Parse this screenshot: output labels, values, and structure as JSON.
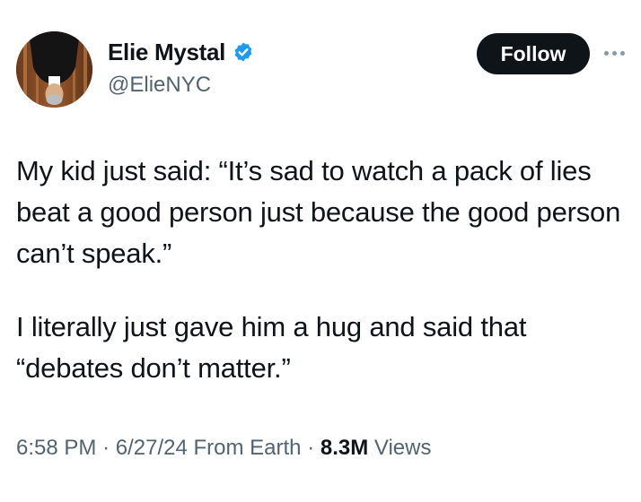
{
  "author": {
    "display_name": "Elie Mystal",
    "handle": "@ElieNYC",
    "verified": true,
    "verified_color": "#1d9bf0",
    "avatar_icon": "profile-photo"
  },
  "actions": {
    "follow_label": "Follow",
    "more_icon": "more-options-icon"
  },
  "tweet": {
    "paragraphs": [
      "My kid just said: “It’s sad to watch a pack of lies beat a good person just because the good person can’t speak.”",
      "I literally just gave him a hug and said that “debates don’t matter.”"
    ]
  },
  "meta": {
    "time": "6:58 PM",
    "separator": "·",
    "date": "6/27/24",
    "source": "From Earth",
    "views_count": "8.3M",
    "views_label": "Views"
  },
  "colors": {
    "text_primary": "#0f1419",
    "text_secondary": "#536471",
    "follow_bg": "#0f1419",
    "follow_text": "#ffffff"
  }
}
